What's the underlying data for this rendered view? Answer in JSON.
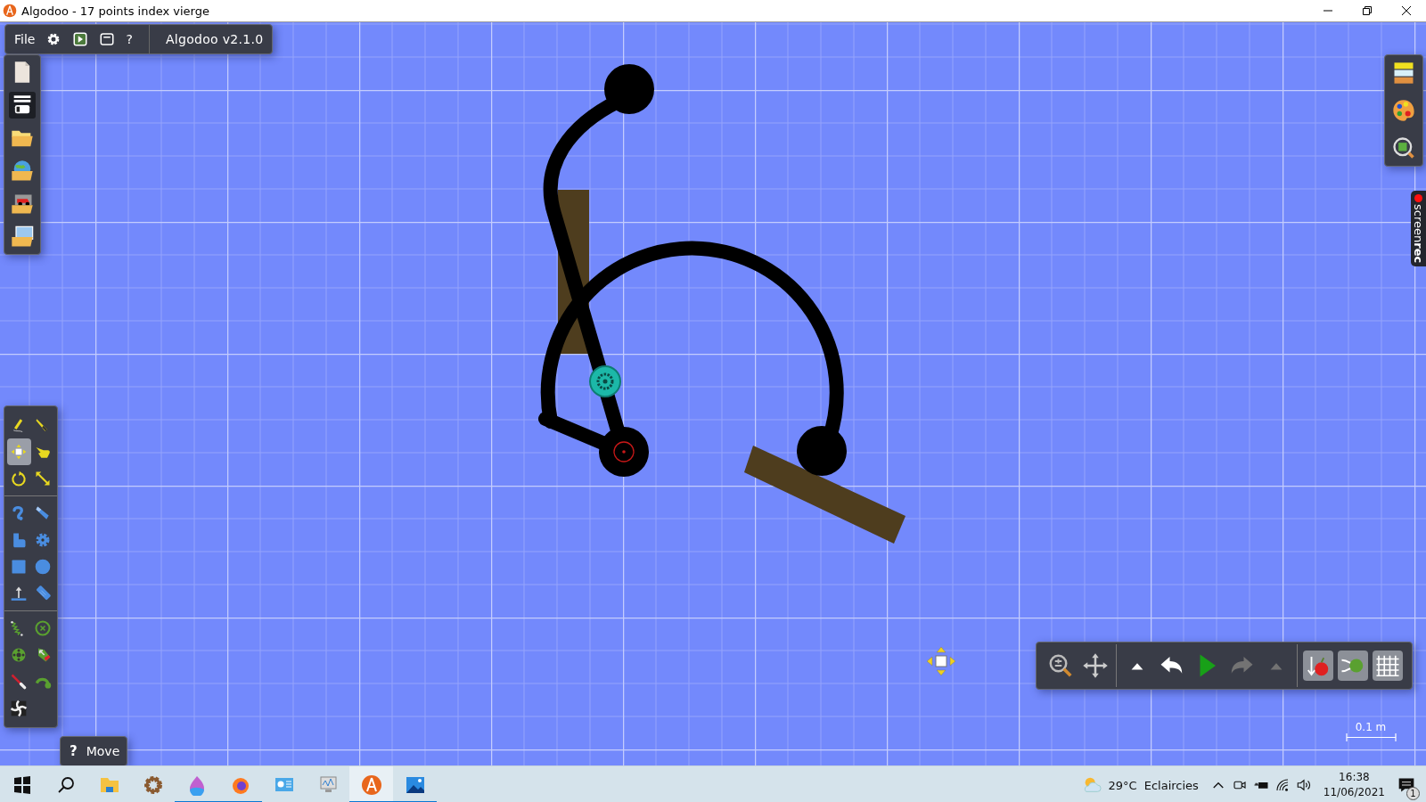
{
  "window": {
    "title": "Algodoo - 17 points index vierge"
  },
  "menu_bar": {
    "items": [
      {
        "kind": "text",
        "label": "File"
      },
      {
        "kind": "settings"
      },
      {
        "kind": "simulation"
      },
      {
        "kind": "window"
      },
      {
        "kind": "text",
        "label": "?"
      }
    ],
    "version": "Algodoo v2.1.0"
  },
  "file_panel": {
    "items": [
      {
        "kind": "new",
        "highlighted": false
      },
      {
        "kind": "save",
        "highlighted": true
      },
      {
        "kind": "open",
        "highlighted": false
      },
      {
        "kind": "online",
        "highlighted": false
      },
      {
        "kind": "scenes",
        "highlighted": false
      },
      {
        "kind": "images",
        "highlighted": false
      }
    ]
  },
  "tool_panel": {
    "groups": [
      {
        "tools": [
          {
            "kind": "sketch",
            "selected": false
          },
          {
            "kind": "cut",
            "selected": false
          },
          {
            "kind": "move",
            "selected": true
          },
          {
            "kind": "drag",
            "selected": false
          },
          {
            "kind": "rotate",
            "selected": false
          },
          {
            "kind": "scale",
            "selected": false
          }
        ]
      },
      {
        "tools": [
          {
            "kind": "brush",
            "selected": false
          },
          {
            "kind": "knife",
            "selected": false
          },
          {
            "kind": "polygon",
            "selected": false
          },
          {
            "kind": "gear",
            "selected": false
          },
          {
            "kind": "box",
            "selected": false
          },
          {
            "kind": "circle",
            "selected": false
          },
          {
            "kind": "plane",
            "selected": false
          },
          {
            "kind": "chain",
            "selected": false
          }
        ]
      },
      {
        "tools": [
          {
            "kind": "spring",
            "selected": false
          },
          {
            "kind": "fixate",
            "selected": false
          },
          {
            "kind": "axle",
            "selected": false
          },
          {
            "kind": "tracer",
            "selected": false
          },
          {
            "kind": "laser",
            "selected": false
          },
          {
            "kind": "thruster",
            "selected": false
          },
          {
            "kind": "texture",
            "selected": false
          }
        ]
      }
    ]
  },
  "help_hint": {
    "icon": "?",
    "label": "Move"
  },
  "side_panel": {
    "items": [
      {
        "kind": "materials"
      },
      {
        "kind": "palette"
      },
      {
        "kind": "inspect"
      }
    ]
  },
  "recorder_tab": {
    "label": "screen**rec**"
  },
  "sim_toolbar": {
    "groups": [
      {
        "items": [
          {
            "kind": "zoom",
            "on": false,
            "disabled": false
          },
          {
            "kind": "pan",
            "on": false,
            "disabled": false
          }
        ]
      },
      {
        "items": [
          {
            "kind": "up",
            "on": false,
            "disabled": false
          },
          {
            "kind": "undo",
            "on": false,
            "disabled": false
          },
          {
            "kind": "play",
            "on": false,
            "disabled": false
          },
          {
            "kind": "redo",
            "on": false,
            "disabled": true
          },
          {
            "kind": "up",
            "on": false,
            "disabled": true
          }
        ]
      },
      {
        "items": [
          {
            "kind": "gravity",
            "on": true,
            "disabled": false
          },
          {
            "kind": "airfriction",
            "on": true,
            "disabled": false
          },
          {
            "kind": "grid",
            "on": true,
            "disabled": false
          }
        ]
      }
    ]
  },
  "scale_bar": {
    "label": "0.1 m"
  },
  "taskbar": {
    "apps": [
      {
        "kind": "start",
        "running": false,
        "selected": false
      },
      {
        "kind": "search",
        "running": false,
        "selected": false
      },
      {
        "kind": "explorer",
        "running": false,
        "selected": false
      },
      {
        "kind": "settings",
        "running": false,
        "selected": false
      },
      {
        "kind": "paint",
        "running": true,
        "selected": false
      },
      {
        "kind": "firefox",
        "running": true,
        "selected": false
      },
      {
        "kind": "monitor",
        "running": false,
        "selected": false
      },
      {
        "kind": "performance",
        "running": false,
        "selected": false
      },
      {
        "kind": "algodoo",
        "running": true,
        "selected": true
      },
      {
        "kind": "photos",
        "running": true,
        "selected": false
      }
    ],
    "weather": {
      "temperature": "29°C",
      "condition": "Eclaircies"
    },
    "tray": [
      {
        "kind": "chevron"
      },
      {
        "kind": "camera"
      },
      {
        "kind": "battery"
      },
      {
        "kind": "wifi"
      },
      {
        "kind": "volume"
      }
    ],
    "clock": {
      "time": "16:38",
      "date": "11/06/2021"
    },
    "notifications": {
      "count": "1"
    }
  }
}
